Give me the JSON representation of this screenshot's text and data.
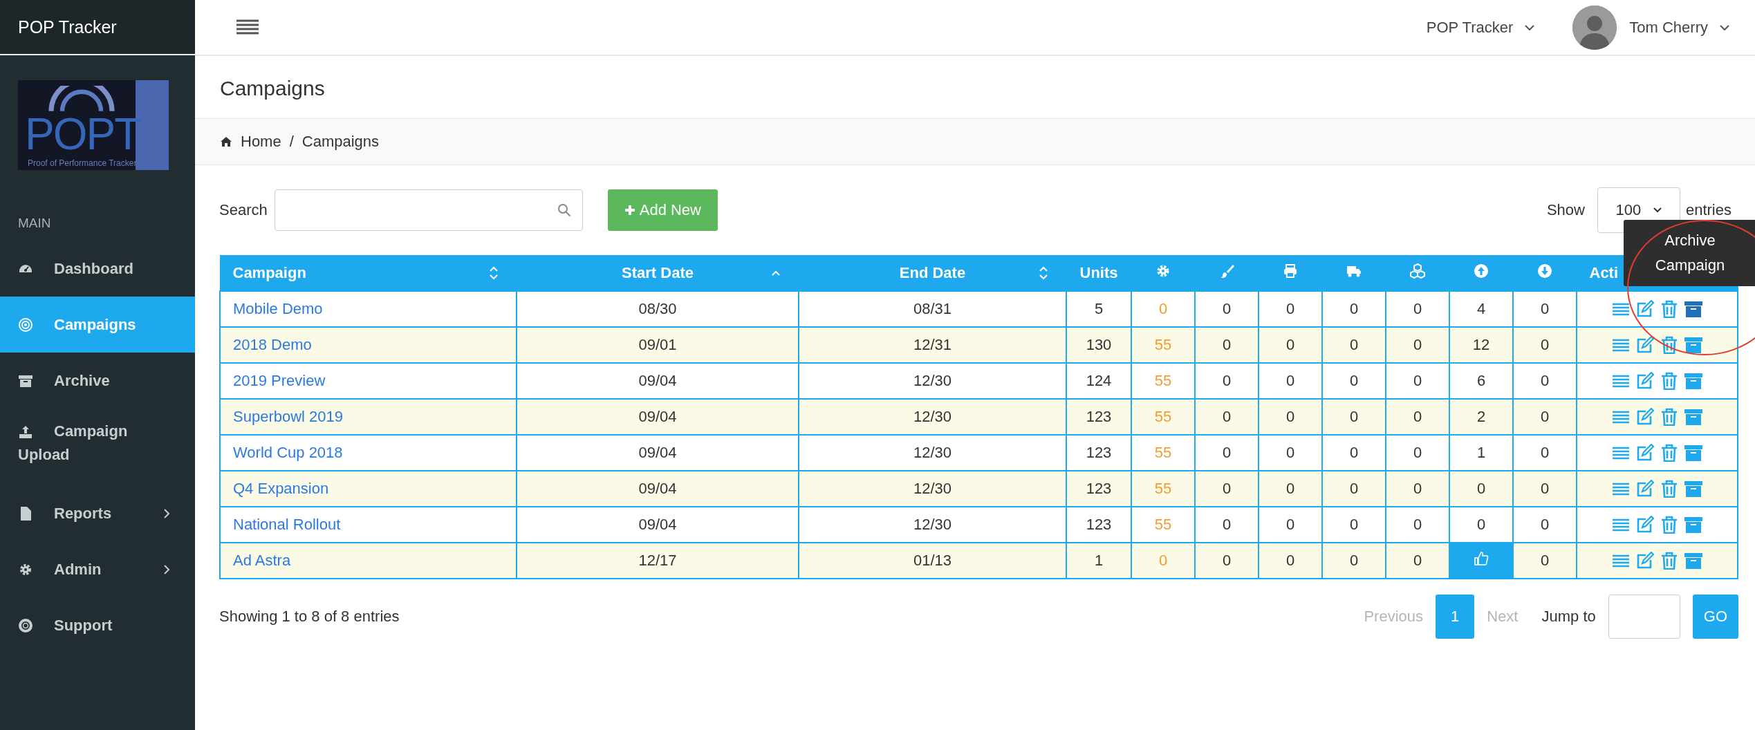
{
  "app_title": "POP Tracker",
  "logo": {
    "title": "POPT",
    "subtitle": "Proof of Performance Tracker"
  },
  "sidebar": {
    "section": "MAIN",
    "items": [
      {
        "label": "Dashboard",
        "selected": false,
        "expandable": false
      },
      {
        "label": "Campaigns",
        "selected": true,
        "expandable": false
      },
      {
        "label": "Archive",
        "selected": false,
        "expandable": false
      },
      {
        "label": "Campaign Upload",
        "selected": false,
        "expandable": false
      },
      {
        "label": "Reports",
        "selected": false,
        "expandable": true
      },
      {
        "label": "Admin",
        "selected": false,
        "expandable": true
      },
      {
        "label": "Support",
        "selected": false,
        "expandable": false
      }
    ]
  },
  "topbar": {
    "app_menu": "POP Tracker",
    "user": "Tom Cherry"
  },
  "page_title": "Campaigns",
  "breadcrumb": {
    "items": [
      "Home",
      "Campaigns"
    ],
    "separator": "/"
  },
  "search": {
    "label": "Search"
  },
  "add_button": "Add New",
  "length": {
    "before": "Show",
    "value": "100",
    "after": "entries"
  },
  "table": {
    "columns": [
      {
        "kind": "text",
        "label": "Campaign",
        "sortable": true,
        "sorted_asc": false
      },
      {
        "kind": "text",
        "label": "Start Date",
        "sortable": true,
        "sorted_asc": true
      },
      {
        "kind": "text",
        "label": "End Date",
        "sortable": true,
        "sorted_asc": false
      },
      {
        "kind": "text",
        "label": "Units",
        "sortable": false
      },
      {
        "kind": "icon"
      },
      {
        "kind": "icon"
      },
      {
        "kind": "icon"
      },
      {
        "kind": "icon"
      },
      {
        "kind": "icon"
      },
      {
        "kind": "icon"
      },
      {
        "kind": "icon"
      },
      {
        "kind": "text",
        "label": "Acti",
        "sortable": false
      }
    ],
    "rows": [
      {
        "campaign": "Mobile Demo",
        "start": "08/30",
        "end": "08/31",
        "units": "5",
        "counts": [
          "0",
          "0",
          "0",
          "0",
          "0"
        ],
        "up": "4",
        "up_done": false,
        "down": "0",
        "archive_hover": true
      },
      {
        "campaign": "2018 Demo",
        "start": "09/01",
        "end": "12/31",
        "units": "130",
        "counts": [
          "55",
          "0",
          "0",
          "0",
          "0"
        ],
        "up": "12",
        "up_done": false,
        "down": "0",
        "archive_hover": false
      },
      {
        "campaign": "2019 Preview",
        "start": "09/04",
        "end": "12/30",
        "units": "124",
        "counts": [
          "55",
          "0",
          "0",
          "0",
          "0"
        ],
        "up": "6",
        "up_done": false,
        "down": "0",
        "archive_hover": false
      },
      {
        "campaign": "Superbowl 2019",
        "start": "09/04",
        "end": "12/30",
        "units": "123",
        "counts": [
          "55",
          "0",
          "0",
          "0",
          "0"
        ],
        "up": "2",
        "up_done": false,
        "down": "0",
        "archive_hover": false
      },
      {
        "campaign": "World Cup 2018",
        "start": "09/04",
        "end": "12/30",
        "units": "123",
        "counts": [
          "55",
          "0",
          "0",
          "0",
          "0"
        ],
        "up": "1",
        "up_done": false,
        "down": "0",
        "archive_hover": false
      },
      {
        "campaign": "Q4 Expansion",
        "start": "09/04",
        "end": "12/30",
        "units": "123",
        "counts": [
          "55",
          "0",
          "0",
          "0",
          "0"
        ],
        "up": "0",
        "up_done": false,
        "down": "0",
        "archive_hover": false
      },
      {
        "campaign": "National Rollout",
        "start": "09/04",
        "end": "12/30",
        "units": "123",
        "counts": [
          "55",
          "0",
          "0",
          "0",
          "0"
        ],
        "up": "0",
        "up_done": false,
        "down": "0",
        "archive_hover": false
      },
      {
        "campaign": "Ad Astra",
        "start": "12/17",
        "end": "01/13",
        "units": "1",
        "counts": [
          "0",
          "0",
          "0",
          "0",
          "0"
        ],
        "up_done": true,
        "down": "0",
        "archive_hover": false
      }
    ]
  },
  "tooltip": "Archive Campaign",
  "info": "Showing 1 to 8 of 8 entries",
  "pagination": {
    "previous": {
      "label": "Previous",
      "disabled": true
    },
    "pages": [
      {
        "label": "1",
        "selected": true
      }
    ],
    "next": {
      "label": "Next",
      "disabled": true
    },
    "jump_label": "Jump to",
    "go": "GO"
  }
}
